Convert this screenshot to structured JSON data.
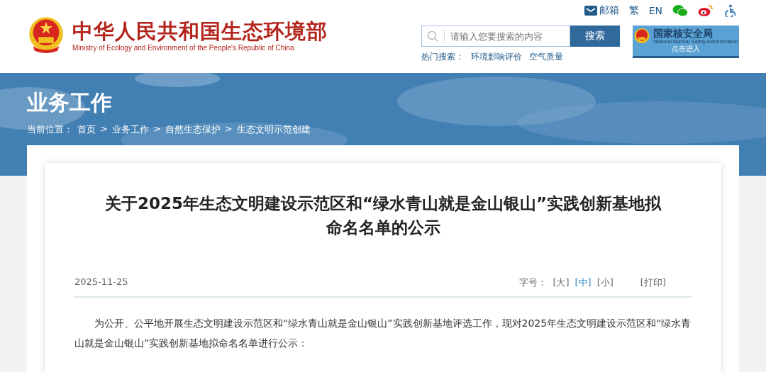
{
  "header": {
    "title": "中华人民共和国生态环境部",
    "subtitle": "Ministry of Ecology and Environment of the People's Republic of China",
    "top_links": [
      {
        "kind": "mail",
        "label": "邮箱"
      },
      {
        "kind": "text",
        "label": "繁"
      },
      {
        "kind": "text",
        "label": "EN"
      },
      {
        "kind": "wechat"
      },
      {
        "kind": "weibo"
      },
      {
        "kind": "accessibility"
      }
    ],
    "search": {
      "placeholder": "请输入您要搜索的内容",
      "button": "搜索"
    },
    "hot_search": {
      "label": "热门搜索：",
      "items": [
        "环境影响评价",
        "空气质量"
      ]
    },
    "partner": {
      "title": "国家核安全局",
      "subtitle": "National Nuclear Safety Administration",
      "action": "点击进入"
    }
  },
  "banner": {
    "kind": "picture",
    "title": "业务工作",
    "breadcrumb": {
      "label": "当前位置：",
      "items": [
        "首页",
        "业务工作",
        "自然生态保护",
        "生态文明示范创建"
      ],
      "separator": ">"
    }
  },
  "article": {
    "title": "关于2025年生态文明建设示范区和“绿水青山就是金山银山”实践创新基地拟命名名单的公示",
    "date": "2025-11-25",
    "font_size": {
      "label": "字号：",
      "options": [
        {
          "label": "[大]",
          "selected": false
        },
        {
          "label": "[中]",
          "selected": true
        },
        {
          "label": "[小]",
          "selected": false
        }
      ]
    },
    "print": "[打印]",
    "body": "为公开、公平地开展生态文明建设示范区和“绿水青山就是金山银山”实践创新基地评选工作，现对2025年生态文明建设示范区和“绿水青山就是金山银山”实践创新基地拟命名名单进行公示："
  }
}
